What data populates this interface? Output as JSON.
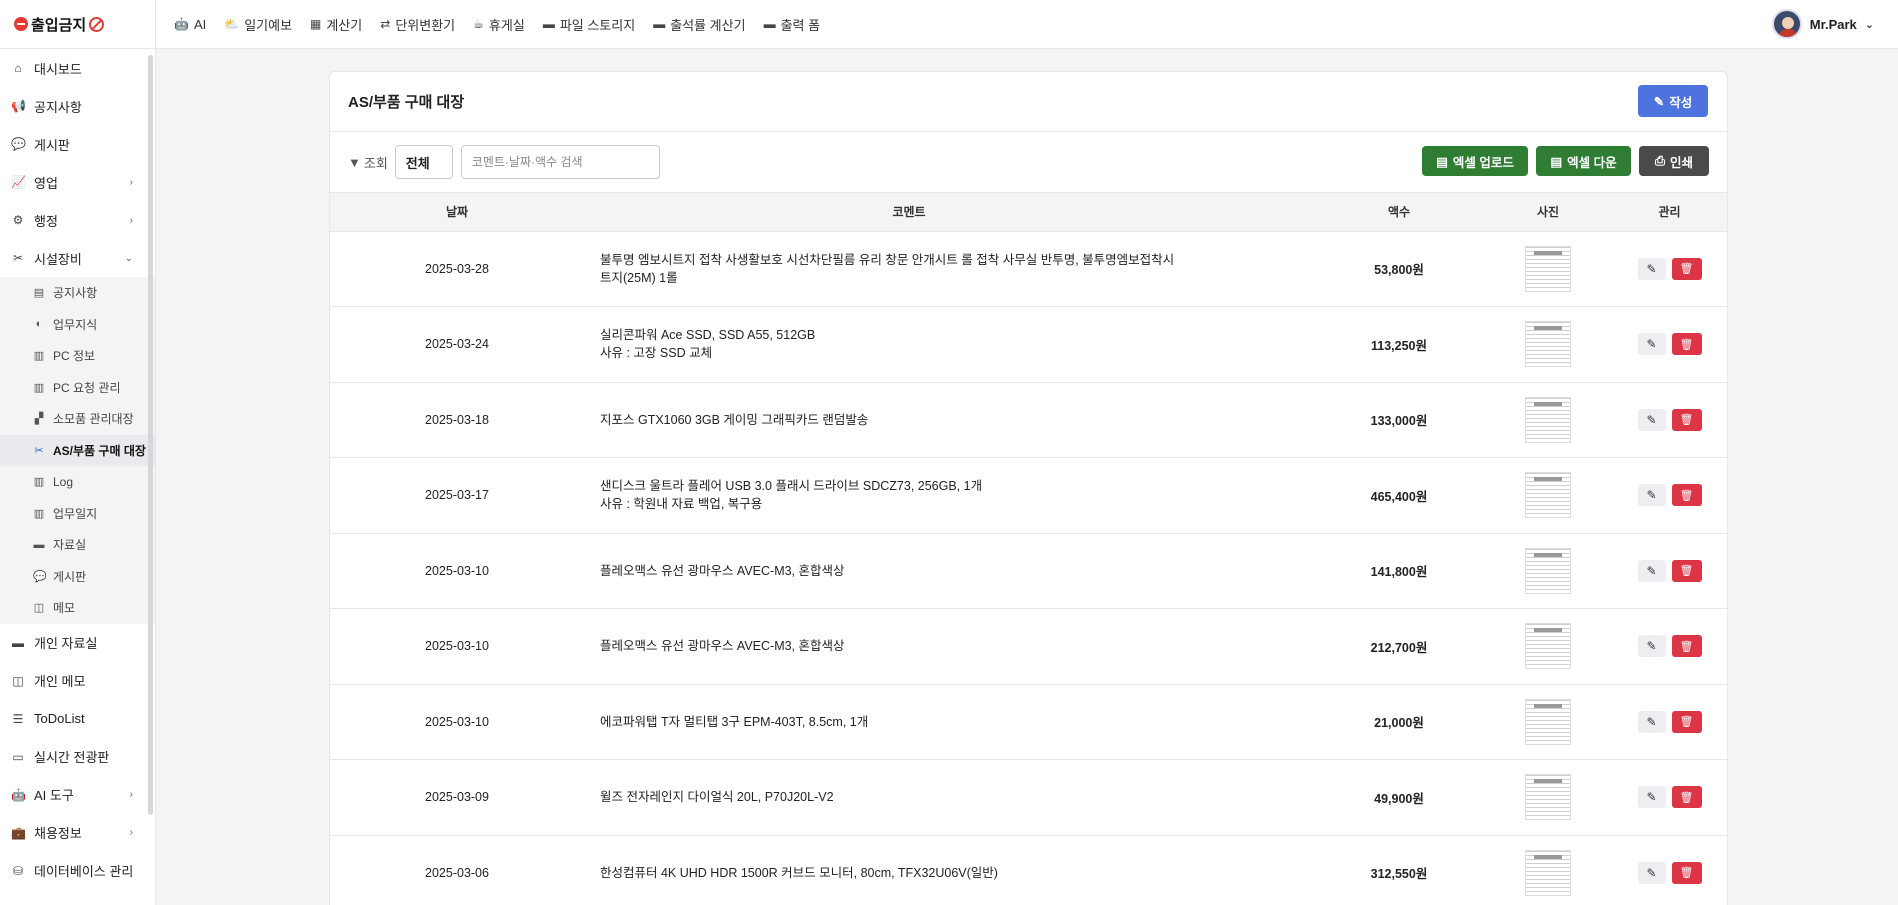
{
  "brand": {
    "title": "출입금지"
  },
  "topnav": [
    {
      "icon": "robot-icon",
      "glyph": "🤖",
      "label": "AI"
    },
    {
      "icon": "cloud-sun-icon",
      "glyph": "⛅",
      "label": "일기예보"
    },
    {
      "icon": "calculator-icon",
      "glyph": "▦",
      "label": "계산기"
    },
    {
      "icon": "exchange-icon",
      "glyph": "⇄",
      "label": "단위변환기"
    },
    {
      "icon": "mug-icon",
      "glyph": "☕",
      "label": "휴게실"
    },
    {
      "icon": "folder-icon",
      "glyph": "▬",
      "label": "파일 스토리지"
    },
    {
      "icon": "folder-icon",
      "glyph": "▬",
      "label": "출석률 계산기"
    },
    {
      "icon": "folder-icon",
      "glyph": "▬",
      "label": "출력 폼"
    }
  ],
  "user": {
    "name": "Mr.Park"
  },
  "sidebar": {
    "top_items": [
      {
        "icon": "home-icon",
        "glyph": "⌂",
        "label": "대시보드"
      },
      {
        "icon": "bullhorn-icon",
        "glyph": "📢",
        "label": "공지사항"
      },
      {
        "icon": "comments-icon",
        "glyph": "💬",
        "label": "게시판"
      },
      {
        "icon": "chart-line-icon",
        "glyph": "📈",
        "label": "영업",
        "chevron": "›"
      },
      {
        "icon": "cogs-icon",
        "glyph": "⚙",
        "label": "행정",
        "chevron": "›"
      },
      {
        "icon": "tools-icon",
        "glyph": "✂",
        "label": "시설장비",
        "chevron": "⌄"
      }
    ],
    "sub_items": [
      {
        "icon": "clipboard-icon",
        "glyph": "▤",
        "label": "공지사항"
      },
      {
        "icon": "brain-icon",
        "glyph": "◐",
        "label": "업무지식"
      },
      {
        "icon": "book-icon",
        "glyph": "▥",
        "label": "PC 정보"
      },
      {
        "icon": "book-icon",
        "glyph": "▥",
        "label": "PC 요청 관리"
      },
      {
        "icon": "boxes-icon",
        "glyph": "▞",
        "label": "소모품 관리대장"
      },
      {
        "icon": "tools-icon",
        "glyph": "✂",
        "label": "AS/부품 구매 대장",
        "active": true
      },
      {
        "icon": "book-icon",
        "glyph": "▥",
        "label": "Log"
      },
      {
        "icon": "book-icon",
        "glyph": "▥",
        "label": "업무일지"
      },
      {
        "icon": "folder-icon",
        "glyph": "▬",
        "label": "자료실"
      },
      {
        "icon": "comments-icon",
        "glyph": "💬",
        "label": "게시판"
      },
      {
        "icon": "sticky-note-icon",
        "glyph": "◫",
        "label": "메모"
      }
    ],
    "bottom_items": [
      {
        "icon": "folder-icon",
        "glyph": "▬",
        "label": "개인 자료실"
      },
      {
        "icon": "sticky-note-icon",
        "glyph": "◫",
        "label": "개인 메모"
      },
      {
        "icon": "list-check-icon",
        "glyph": "☰",
        "label": "ToDoList"
      },
      {
        "icon": "monitor-icon",
        "glyph": "▭",
        "label": "실시간 전광판"
      },
      {
        "icon": "robot-icon",
        "glyph": "🤖",
        "label": "AI 도구",
        "chevron": "›"
      },
      {
        "icon": "briefcase-icon",
        "glyph": "💼",
        "label": "채용정보",
        "chevron": "›"
      },
      {
        "icon": "database-icon",
        "glyph": "⛁",
        "label": "데이터베이스 관리"
      }
    ]
  },
  "page": {
    "title": "AS/부품 구매 대장",
    "write_label": "작성",
    "filter_label": "조회",
    "filter_value": "전체",
    "search_placeholder": "코멘트·날짜·액수 검색",
    "excel_upload_label": "엑셀 업로드",
    "excel_download_label": "엑셀 다운",
    "print_label": "인쇄"
  },
  "table": {
    "columns": [
      "날짜",
      "코멘트",
      "액수",
      "사진",
      "관리"
    ],
    "rows": [
      {
        "date": "2025-03-28",
        "comment": [
          "불투명 엠보시트지 접착 사생활보호 시선차단필름 유리 창문 안개시트 롤 접착 사무실 반투명, 불투명엠보접착시",
          "트지(25M) 1롤"
        ],
        "amount": "53,800원"
      },
      {
        "date": "2025-03-24",
        "comment": [
          "실리콘파워 Ace SSD, SSD A55, 512GB",
          "사유 : 고장 SSD 교체"
        ],
        "amount": "113,250원"
      },
      {
        "date": "2025-03-18",
        "comment": [
          "지포스 GTX1060 3GB 게이밍 그래픽카드 랜덤발송"
        ],
        "amount": "133,000원"
      },
      {
        "date": "2025-03-17",
        "comment": [
          "샌디스크 울트라 플레어 USB 3.0 플래시 드라이브 SDCZ73, 256GB, 1개",
          "사유 : 학원내 자료 백업, 복구용"
        ],
        "amount": "465,400원"
      },
      {
        "date": "2025-03-10",
        "comment": [
          "플레오맥스 유선 광마우스 AVEC-M3, 혼합색상"
        ],
        "amount": "141,800원"
      },
      {
        "date": "2025-03-10",
        "comment": [
          "플레오맥스 유선 광마우스 AVEC-M3, 혼합색상"
        ],
        "amount": "212,700원"
      },
      {
        "date": "2025-03-10",
        "comment": [
          "에코파워탭 T자 멀티탭 3구 EPM-403T, 8.5cm, 1개"
        ],
        "amount": "21,000원"
      },
      {
        "date": "2025-03-09",
        "comment": [
          "윌즈 전자레인지 다이얼식 20L, P70J20L-V2"
        ],
        "amount": "49,900원"
      },
      {
        "date": "2025-03-06",
        "comment": [
          "한성컴퓨터 4K UHD HDR 1500R 커브드 모니터, 80cm, TFX32U06V(일반)"
        ],
        "amount": "312,550원"
      }
    ]
  },
  "colors": {
    "primary": "#4e73df",
    "excel": "#2e7d32",
    "print": "#4a4a4a",
    "delete": "#dc3545",
    "brand_red": "#e53935"
  }
}
